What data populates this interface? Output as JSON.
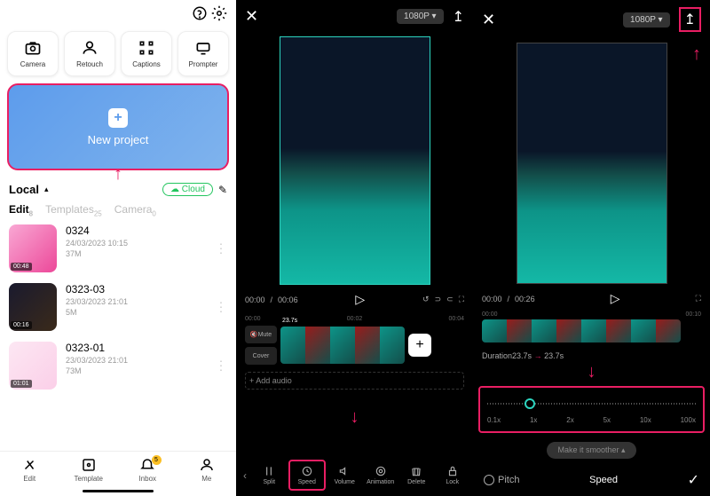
{
  "panel1": {
    "tools": [
      {
        "label": "Camera"
      },
      {
        "label": "Retouch"
      },
      {
        "label": "Captions"
      },
      {
        "label": "Prompter"
      }
    ],
    "newProject": "New project",
    "local": "Local",
    "cloud": "☁ Cloud",
    "tabs": [
      {
        "label": "Edit",
        "count": "8",
        "active": true
      },
      {
        "label": "Templates",
        "count": "25",
        "active": false
      },
      {
        "label": "Camera",
        "count": "0",
        "active": false
      }
    ],
    "items": [
      {
        "title": "0324",
        "date": "24/03/2023 10:15",
        "size": "37M",
        "dur": "00:48"
      },
      {
        "title": "0323-03",
        "date": "23/03/2023 21:01",
        "size": "5M",
        "dur": "00:16"
      },
      {
        "title": "0323-01",
        "date": "23/03/2023 21:01",
        "size": "73M",
        "dur": "01:01"
      }
    ],
    "nav": [
      {
        "label": "Edit"
      },
      {
        "label": "Template"
      },
      {
        "label": "Inbox",
        "badge": "5"
      },
      {
        "label": "Me"
      }
    ]
  },
  "panel2": {
    "resolution": "1080P",
    "time": {
      "current": "00:00",
      "total": "00:06"
    },
    "timeMarks": [
      "00:00",
      "00:02",
      "00:04"
    ],
    "mute": "Mute",
    "cover": "Cover",
    "clipDur": "23.7s",
    "addAudio": "+ Add audio",
    "tools": [
      "Split",
      "Speed",
      "Volume",
      "Animation",
      "Delete",
      "Lock"
    ]
  },
  "panel3": {
    "resolution": "1080P",
    "time": {
      "current": "00:00",
      "total": "00:26"
    },
    "timeMarks": [
      "00:00",
      "00:10"
    ],
    "duration": "Duration23.7s",
    "durationArrow": "23.7s",
    "speedLabels": [
      "0.1x",
      "1x",
      "2x",
      "5x",
      "10x",
      "100x"
    ],
    "smoother": "Make it smoother",
    "pitch": "Pitch",
    "speed": "Speed"
  }
}
